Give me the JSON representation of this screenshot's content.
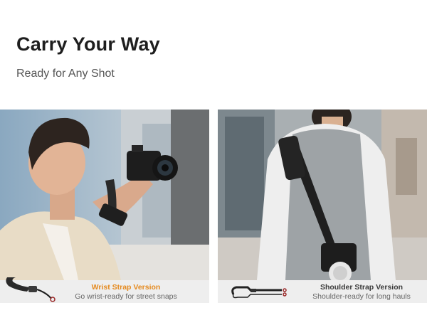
{
  "header": {
    "title": "Carry Your Way",
    "subtitle": "Ready for Any Shot"
  },
  "panels": [
    {
      "title": "Wrist Strap Version",
      "description": "Go wrist-ready for street snaps",
      "title_color": "#e58a1f"
    },
    {
      "title": "Shoulder Strap Version",
      "description": "Shoulder-ready for long hauls",
      "title_color": "#3a3a3a"
    }
  ]
}
